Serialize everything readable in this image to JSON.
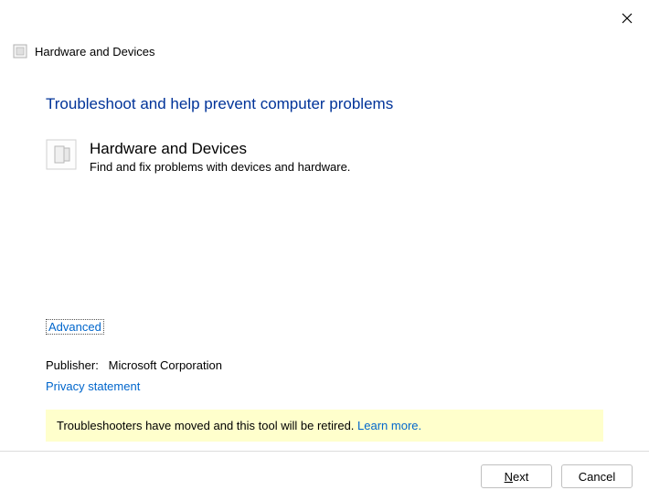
{
  "window": {
    "title": "Hardware and Devices"
  },
  "content": {
    "heading": "Troubleshoot and help prevent computer problems",
    "troubleshooter": {
      "title": "Hardware and Devices",
      "description": "Find and fix problems with devices and hardware."
    },
    "advanced_label": "Advanced",
    "publisher_label": "Publisher:",
    "publisher_value": "Microsoft Corporation",
    "privacy_label": "Privacy statement",
    "notice_text": "Troubleshooters have moved and this tool will be retired. ",
    "learn_more_label": "Learn more."
  },
  "footer": {
    "next_label": "Next",
    "cancel_label": "Cancel"
  }
}
